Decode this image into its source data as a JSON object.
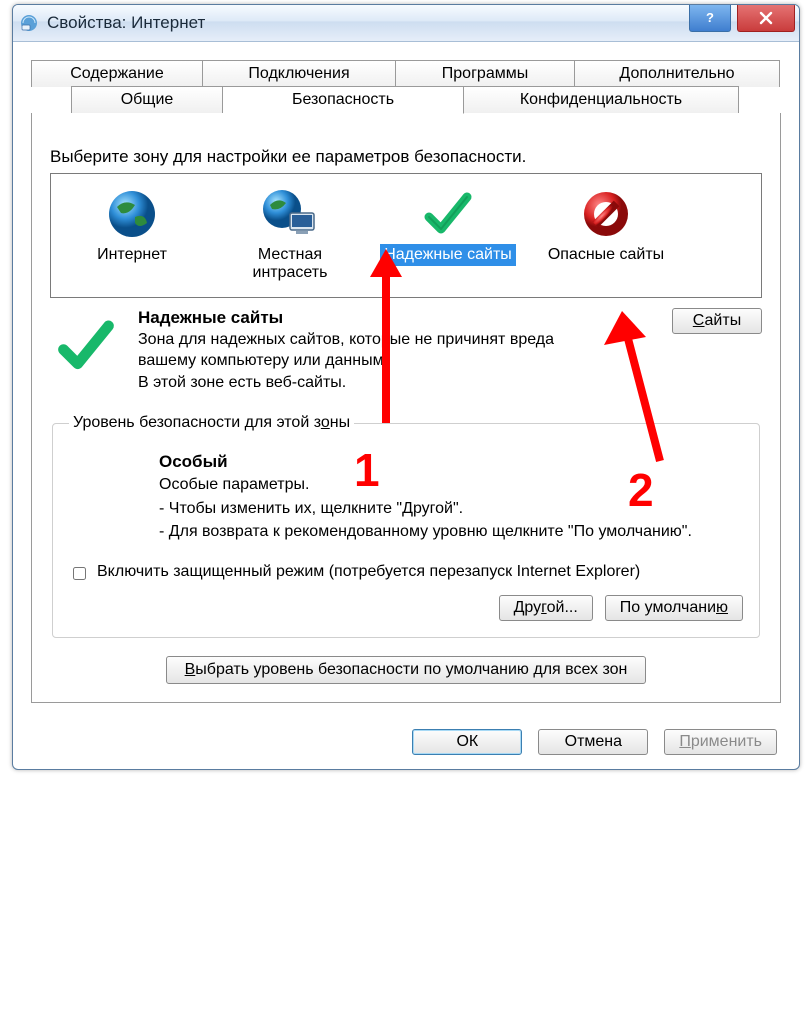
{
  "window": {
    "title": "Свойства: Интернет"
  },
  "title_controls": {
    "help": "?",
    "close": "X"
  },
  "tabs": {
    "row1": [
      {
        "label": "Содержание"
      },
      {
        "label": "Подключения"
      },
      {
        "label": "Программы"
      },
      {
        "label": "Дополнительно"
      }
    ],
    "row2": [
      {
        "label": "Общие"
      },
      {
        "label": "Безопасность",
        "active": true
      },
      {
        "label": "Конфиденциальность"
      }
    ]
  },
  "security": {
    "instruction": "Выберите зону для настройки ее параметров безопасности.",
    "zones": [
      {
        "label": "Интернет"
      },
      {
        "label": "Местная интрасеть"
      },
      {
        "label": "Надежные сайты",
        "selected": true
      },
      {
        "label": "Опасные сайты"
      }
    ],
    "detail": {
      "title": "Надежные сайты",
      "line1": "Зона для надежных сайтов, которые не причинят вреда вашему компьютеру или данным.",
      "line2": "В этой зоне есть веб-сайты."
    },
    "sites_btn": "Сайты",
    "level_legend": "Уровень безопасности для этой зоны",
    "level": {
      "title": "Особый",
      "line1": "Особые параметры.",
      "line2": "- Чтобы изменить их, щелкните \"Другой\".",
      "line3": "- Для возврата к рекомендованному уровню щелкните \"По умолчанию\"."
    },
    "protected_mode": "Включить защищенный режим (потребуется перезапуск Internet Explorer)",
    "custom_btn": "Другой...",
    "default_btn": "По умолчанию",
    "reset_all_btn": "Выбрать уровень безопасности по умолчанию для всех зон"
  },
  "footer": {
    "ok": "ОК",
    "cancel": "Отмена",
    "apply": "Применить"
  },
  "annotations": {
    "one": "1",
    "two": "2"
  }
}
